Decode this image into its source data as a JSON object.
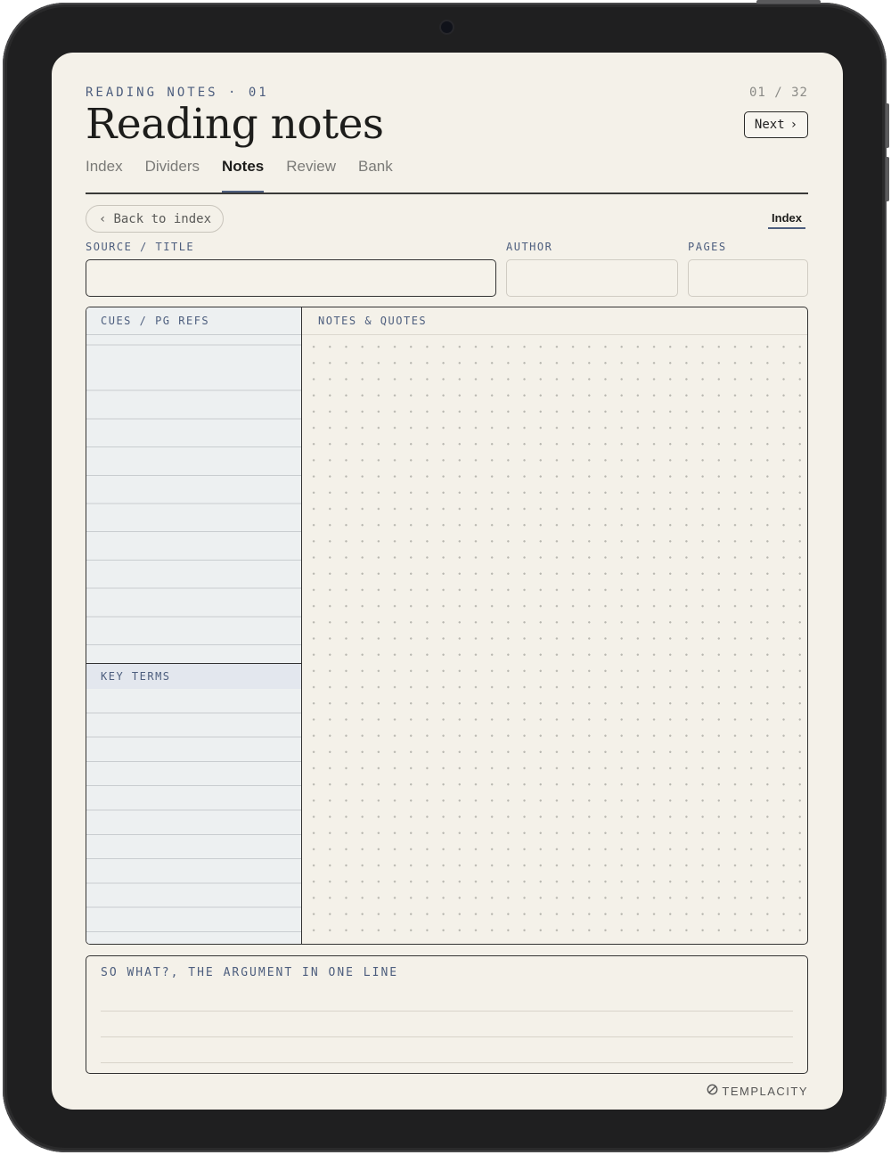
{
  "header": {
    "eyebrow": "READING NOTES · 01",
    "page_counter": "01 / 32",
    "title": "Reading notes",
    "next_label": "Next",
    "next_icon": "chevron-right-icon"
  },
  "tabs": [
    {
      "label": "Index",
      "active": false
    },
    {
      "label": "Dividers",
      "active": false
    },
    {
      "label": "Notes",
      "active": true
    },
    {
      "label": "Review",
      "active": false
    },
    {
      "label": "Bank",
      "active": false
    }
  ],
  "nav": {
    "back_label": "Back to index",
    "back_icon": "chevron-left-icon",
    "index_link": "Index"
  },
  "fields": {
    "source_label": "SOURCE / TITLE",
    "author_label": "AUTHOR",
    "pages_label": "PAGES"
  },
  "cues": {
    "header": "CUES / PG REFS"
  },
  "key_terms": {
    "header": "KEY TERMS"
  },
  "notes": {
    "header": "NOTES & QUOTES"
  },
  "summary": {
    "label": "SO WHAT?, THE ARGUMENT IN ONE LINE"
  },
  "brand": {
    "name": "TEMPLACITY",
    "icon": "templacity-logo-icon"
  },
  "colors": {
    "accent": "#4d5e7e",
    "paper": "#f4f1e9",
    "cue_panel": "#edf0f1",
    "ink": "#1d1d1b"
  }
}
